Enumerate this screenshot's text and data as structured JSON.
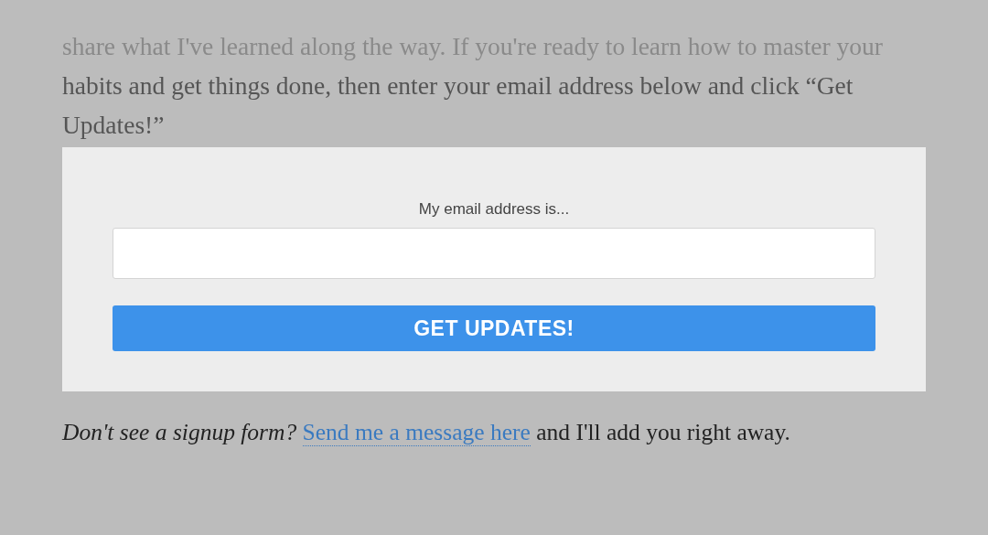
{
  "intro": "share what I've learned along the way. If you're ready to learn how to master your habits and get things done, then enter your email address below and click “Get Updates!”",
  "signup": {
    "label": "My email address is...",
    "button": "GET UPDATES!"
  },
  "footer": {
    "before": "*Don't see a signup form?*",
    "link": "Send me a message here",
    "after": "and I'll add you right away."
  }
}
